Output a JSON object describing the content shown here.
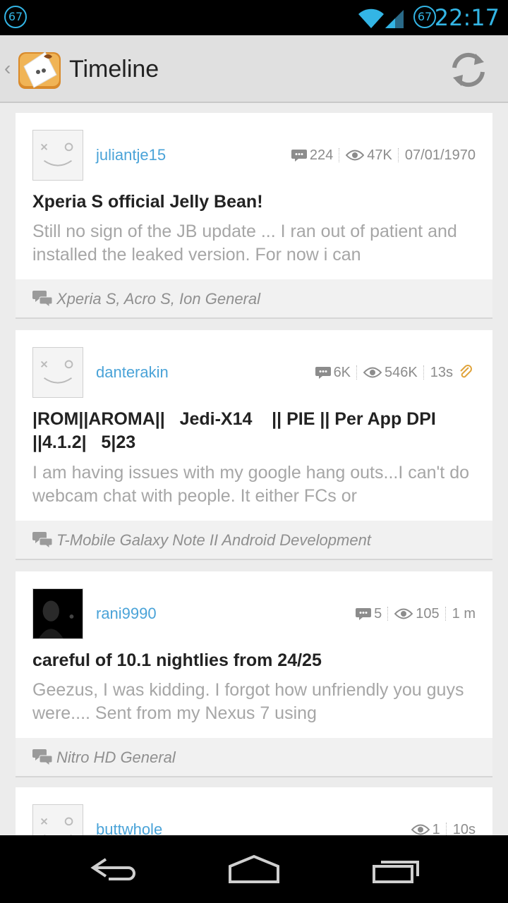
{
  "status_bar": {
    "left_badge": "67",
    "right_badge": "67",
    "time": "22:17"
  },
  "action_bar": {
    "title": "Timeline",
    "app_icon": "xda-app-icon",
    "refresh_icon": "refresh-icon"
  },
  "posts": [
    {
      "username": "juliantje15",
      "replies": "224",
      "views": "47K",
      "time": "07/01/1970",
      "title": "Xperia S official Jelly Bean!",
      "snippet": "Still no sign of the JB update ... I ran out of patient and installed the leaked version. For now i can",
      "forum": "Xperia S, Acro S, Ion General"
    },
    {
      "username": "danterakin",
      "replies": "6K",
      "views": "546K",
      "time": "13s",
      "title": "|ROM||AROMA||   Jedi-X14    || PIE || Per App DPI ||4.1.2|   5|23",
      "snippet": "I am having issues with my google hang outs...I can't do webcam chat with people. It either FCs or",
      "forum": "T-Mobile Galaxy Note II Android Development"
    },
    {
      "username": "rani9990",
      "replies": "5",
      "views": "105",
      "time": "1 m",
      "title": "careful of 10.1 nightlies from 24/25",
      "snippet": "Geezus, I was kidding. I forgot how unfriendly you guys were.... Sent from my Nexus 7 using",
      "forum": "Nitro HD General"
    },
    {
      "username": "buttwhole",
      "views": "1",
      "time": "10s"
    }
  ],
  "nav_bar": {
    "back_icon": "back-icon",
    "home_icon": "home-icon",
    "recents_icon": "recent-apps-icon"
  }
}
